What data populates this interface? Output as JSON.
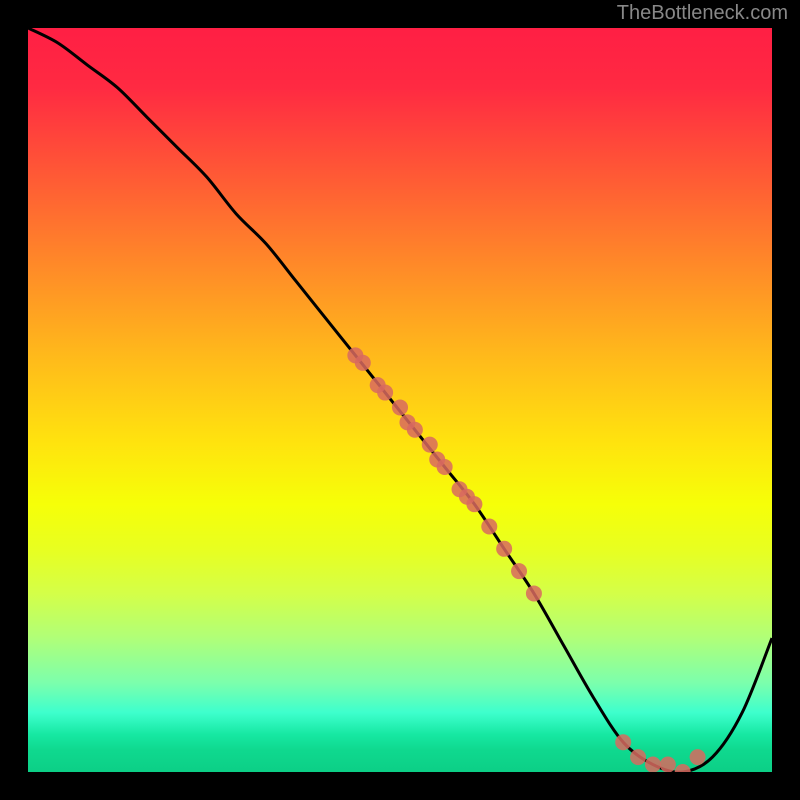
{
  "watermark": "TheBottleneck.com",
  "chart_data": {
    "type": "line",
    "title": "",
    "xlabel": "",
    "ylabel": "",
    "xlim": [
      0,
      100
    ],
    "ylim": [
      0,
      100
    ],
    "grid": false,
    "legend": false,
    "description": "Bottleneck curve over a red-to-green vertical gradient background, with scattered data points along the descending slope and at the trough.",
    "series": [
      {
        "name": "curve",
        "x": [
          0,
          4,
          8,
          12,
          16,
          20,
          24,
          28,
          32,
          36,
          40,
          44,
          48,
          52,
          56,
          60,
          64,
          68,
          72,
          76,
          80,
          84,
          88,
          92,
          96,
          100
        ],
        "y": [
          100,
          98,
          95,
          92,
          88,
          84,
          80,
          75,
          71,
          66,
          61,
          56,
          51,
          46,
          41,
          36,
          30,
          24,
          17,
          10,
          4,
          1,
          0,
          2,
          8,
          18
        ]
      }
    ],
    "points": {
      "name": "data-points",
      "x": [
        44,
        45,
        47,
        48,
        50,
        51,
        52,
        54,
        55,
        56,
        58,
        59,
        60,
        62,
        64,
        66,
        68,
        80,
        82,
        84,
        86,
        88,
        90
      ],
      "y": [
        56,
        55,
        52,
        51,
        49,
        47,
        46,
        44,
        42,
        41,
        38,
        37,
        36,
        33,
        30,
        27,
        24,
        4,
        2,
        1,
        1,
        0,
        2
      ]
    },
    "gradient_stops": [
      {
        "pos": 0.0,
        "color": "#ff1f44"
      },
      {
        "pos": 0.5,
        "color": "#ffd80e"
      },
      {
        "pos": 0.75,
        "color": "#d4ff48"
      },
      {
        "pos": 1.0,
        "color": "#0ccf86"
      }
    ]
  }
}
